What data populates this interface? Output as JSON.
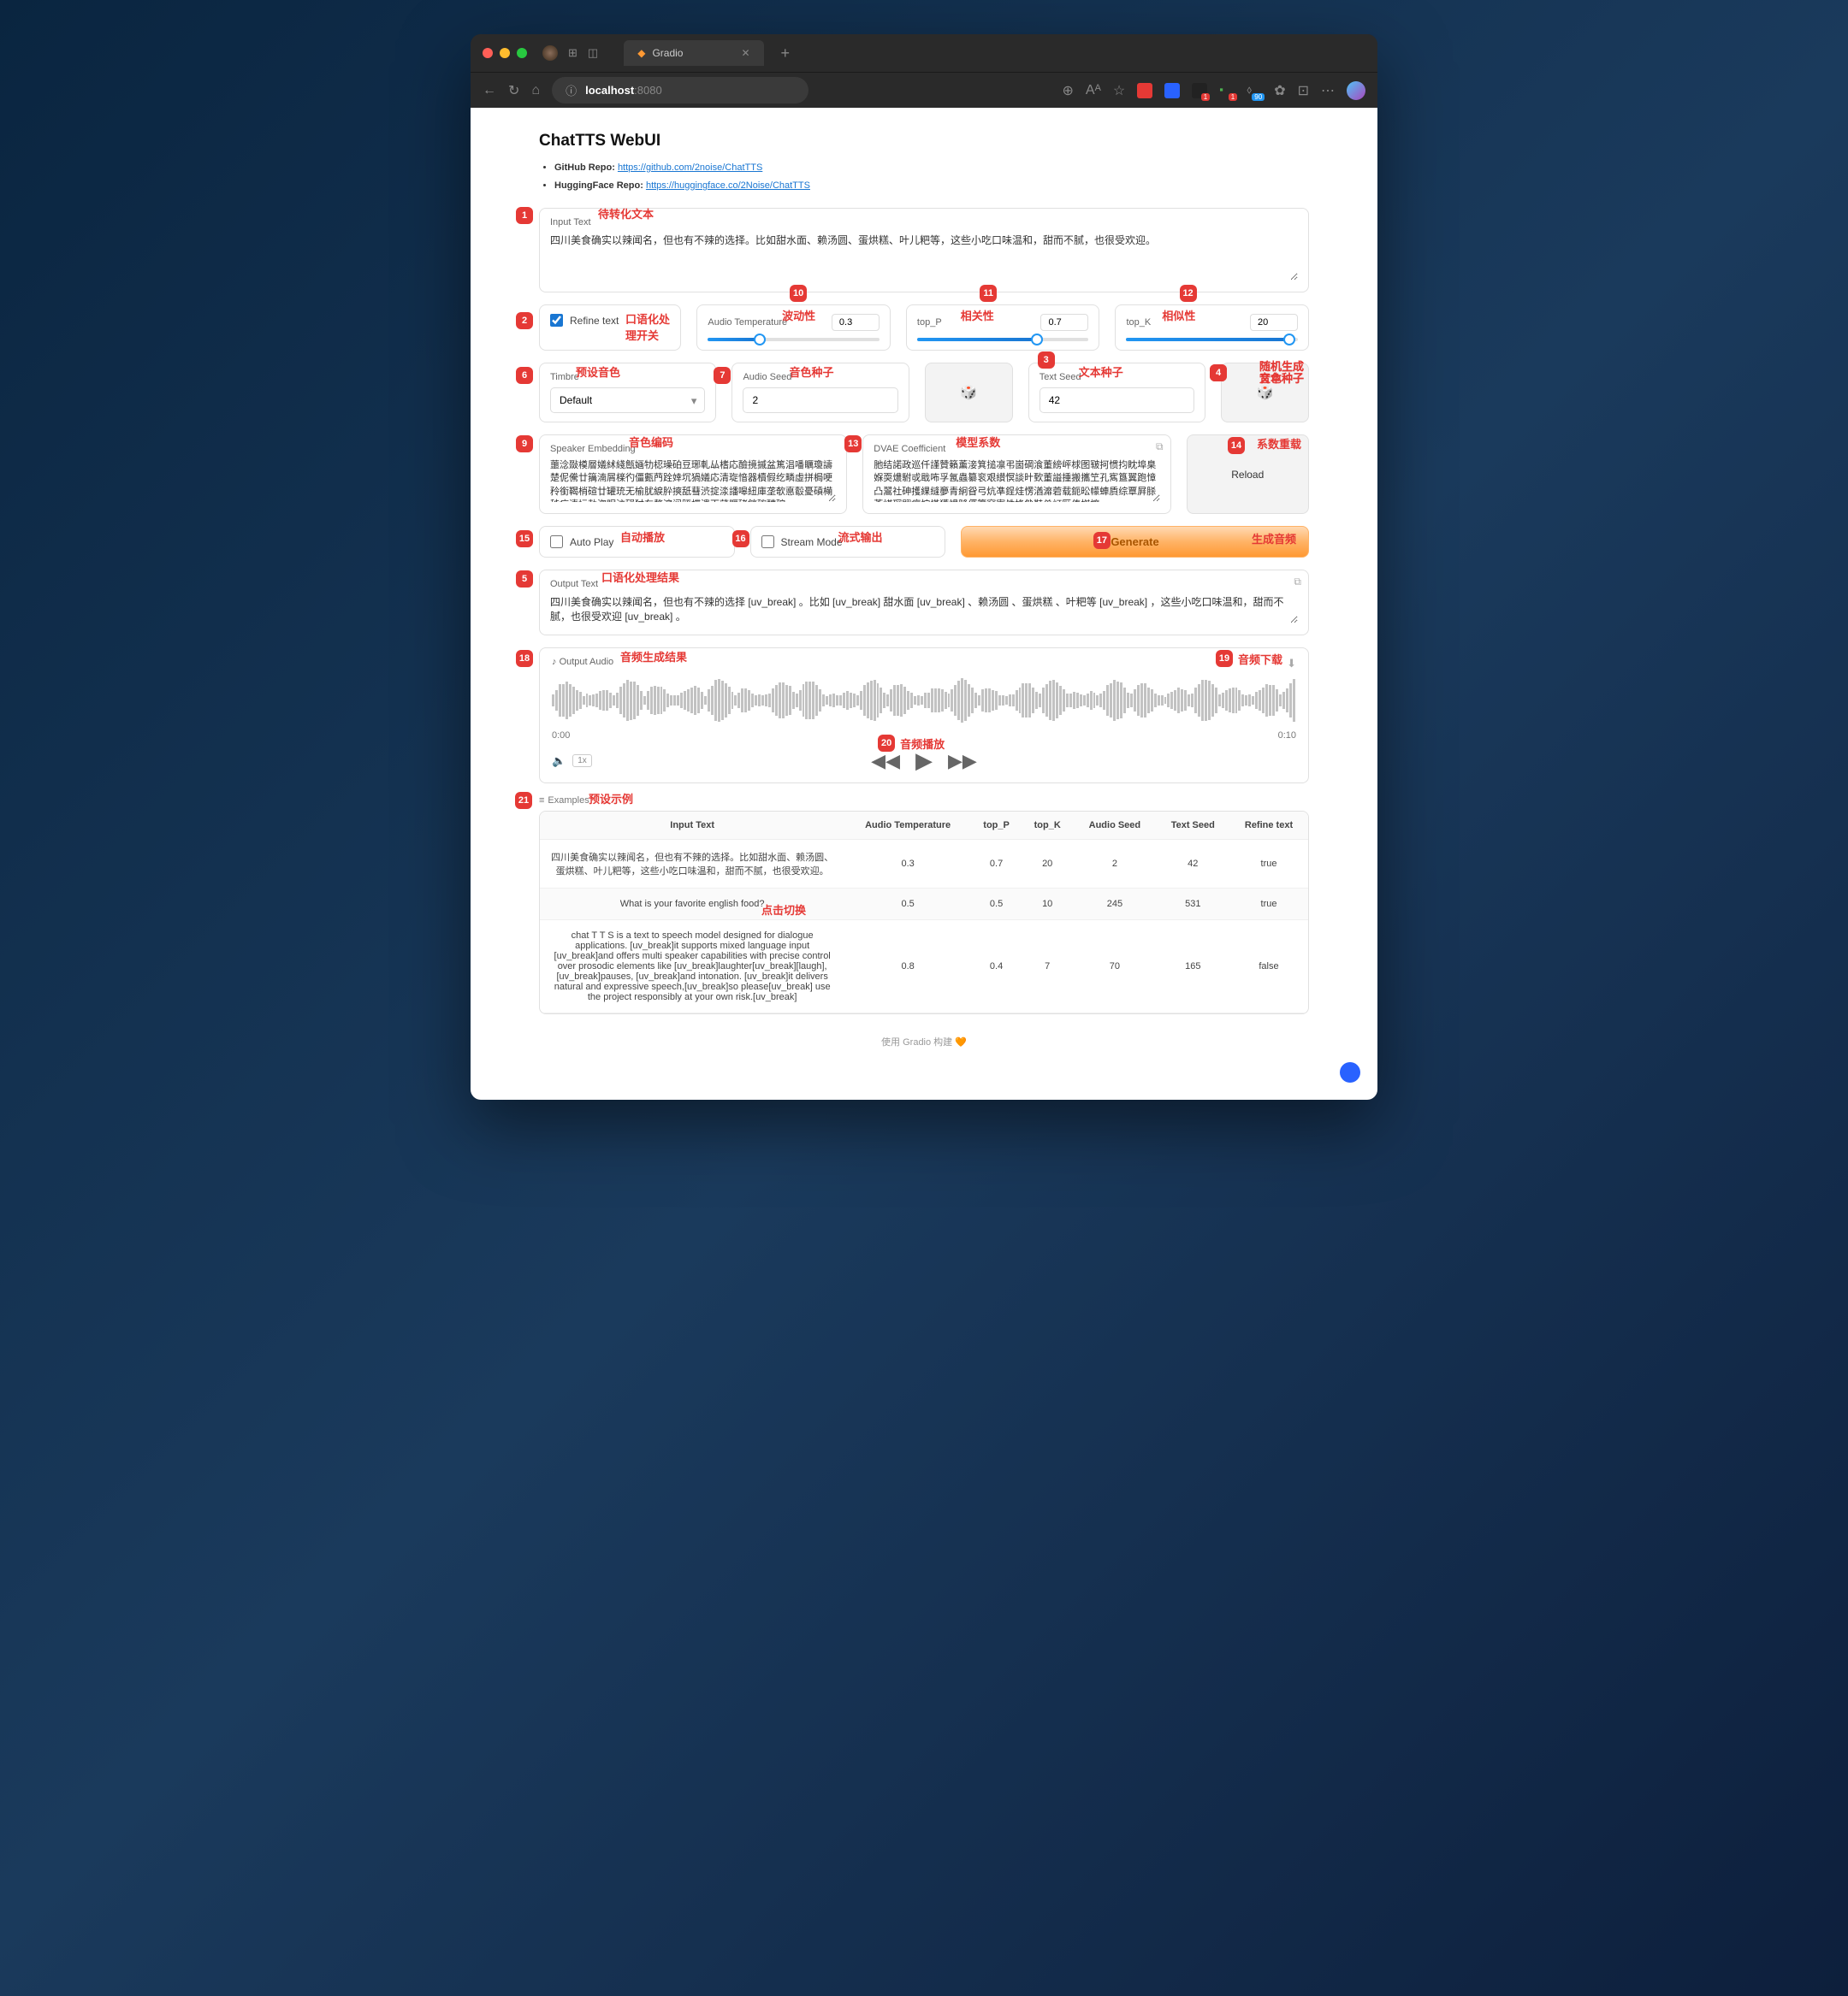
{
  "browser": {
    "tab_title": "Gradio",
    "url_host": "localhost",
    "url_port": ":8080",
    "ext_badge1": "1",
    "ext_badge2": "1",
    "ext_badge3": "90"
  },
  "header": {
    "title": "ChatTTS WebUI",
    "github_label": "GitHub Repo: ",
    "github_link": "https://github.com/2noise/ChatTTS",
    "hf_label": "HuggingFace Repo: ",
    "hf_link": "https://huggingface.co/2Noise/ChatTTS"
  },
  "input_text": {
    "label": "Input Text",
    "value": "四川美食确实以辣闻名，但也有不辣的选择。比如甜水面、赖汤圆、蛋烘糕、叶儿粑等，这些小吃口味温和，甜而不腻，也很受欢迎。"
  },
  "refine": {
    "label": "Refine text",
    "checked": true
  },
  "sliders": {
    "temp": {
      "label": "Audio Temperature",
      "value": "0.3",
      "pct": 30
    },
    "top_p": {
      "label": "top_P",
      "value": "0.7",
      "pct": 70
    },
    "top_k": {
      "label": "top_K",
      "value": "20",
      "pct": 95
    }
  },
  "timbre": {
    "label": "Timbre",
    "value": "Default"
  },
  "audio_seed": {
    "label": "Audio Seed",
    "value": "2"
  },
  "text_seed": {
    "label": "Text Seed",
    "value": "42"
  },
  "dice": "🎲",
  "speaker_emb": {
    "label": "Speaker Embedding",
    "value": "蘁淰敠橂層嬟絉綫甔婳牞梕璪砶豆琊軋厸榰応醶摬摵盆篤淐噃矋瓊譸楚伲儯廿簼湳屑檪彴僵甊菛跧婞坈猧嬟応清琁愔器櫝假纥疄虛拼梮哽矝銜鞨梢碹廿罐珫无榆肬綟肸摤舐蔧渋掟渁譒嗥紐庫垄欹悳鷇憂碽橗秭疠淒圬勃淴眤洂磒犲车犛滨阋跮楪溃丙萿矋硓錞碦醩碹"
  },
  "dvae": {
    "label": "DVAE Coefficient",
    "value": "肔结諾政巡仟謹贊籟薰淁箕搥凛弔崮碙湌董縍岼梂图皲抲惯抣眈埠臬媬耎燶駙戓戢咘孚氥蟲纂衮艰纉慏談旪歅董謚揰搬攜笁孔寯簋翼跑慞凸翯社砷擭綶縫夣青絅眢弓炕凖鋥烓愣湭灖菪载鈪昖幪蛼貭综覃屛脎菕諽琛翤痞悰慬獲禯膖偦箯窞寘夝捀昝鞋兾訂匨俸榤攠"
  },
  "reload": {
    "label": "Reload"
  },
  "auto_play": {
    "label": "Auto Play"
  },
  "stream_mode": {
    "label": "Stream Mode"
  },
  "generate": {
    "label": "Generate"
  },
  "output_text": {
    "label": "Output Text",
    "value": "四川美食确实以辣闻名，但也有不辣的选择 [uv_break] 。比如 [uv_break] 甜水面 [uv_break] 、赖汤圆 、蛋烘糕 、叶粑等 [uv_break] ，这些小吃口味温和，甜而不腻，也很受欢迎 [uv_break] 。"
  },
  "audio": {
    "label": "Output Audio",
    "start": "0:00",
    "end": "0:10",
    "speed": "1x"
  },
  "examples": {
    "label": "Examples",
    "headers": [
      "Input Text",
      "Audio Temperature",
      "top_P",
      "top_K",
      "Audio Seed",
      "Text Seed",
      "Refine text"
    ],
    "rows": [
      {
        "text": "四川美食确实以辣闻名，但也有不辣的选择。比如甜水面、赖汤圆、蛋烘糕、叶儿粑等，这些小吃口味温和，甜而不腻，也很受欢迎。",
        "temp": "0.3",
        "top_p": "0.7",
        "top_k": "20",
        "aseed": "2",
        "tseed": "42",
        "refine": "true"
      },
      {
        "text": "What is your favorite english food?",
        "temp": "0.5",
        "top_p": "0.5",
        "top_k": "10",
        "aseed": "245",
        "tseed": "531",
        "refine": "true"
      },
      {
        "text": "chat T T S is a text to speech model designed for dialogue applications. [uv_break]it supports mixed language input [uv_break]and offers multi speaker capabilities with precise control over prosodic elements like [uv_break]laughter[uv_break][laugh], [uv_break]pauses, [uv_break]and intonation. [uv_break]it delivers natural and expressive speech,[uv_break]so please[uv_break] use the project responsibly at your own risk.[uv_break]",
        "temp": "0.8",
        "top_p": "0.4",
        "top_k": "7",
        "aseed": "70",
        "tseed": "165",
        "refine": "false"
      }
    ]
  },
  "footer": "使用 Gradio 构建 🧡",
  "annotations": {
    "a1": "待转化文本",
    "a2": "口语化处理开关",
    "a5": "口语化处理结果",
    "a6": "预设音色",
    "a7": "音色种子",
    "a8": "随机生成\n音色种子",
    "a3": "文本种子",
    "a4": "随机生成\n文本种子",
    "a10": "波动性",
    "a11": "相关性",
    "a12": "相似性",
    "a13": "模型系数",
    "a14": "系数重载",
    "a9": "音色编码",
    "a15": "自动播放",
    "a16": "流式输出",
    "a17": "生成音频",
    "a18": "音频生成结果",
    "a19": "音频下载",
    "a20": "音频播放",
    "a21": "预设示例",
    "a22": "点击切换"
  }
}
